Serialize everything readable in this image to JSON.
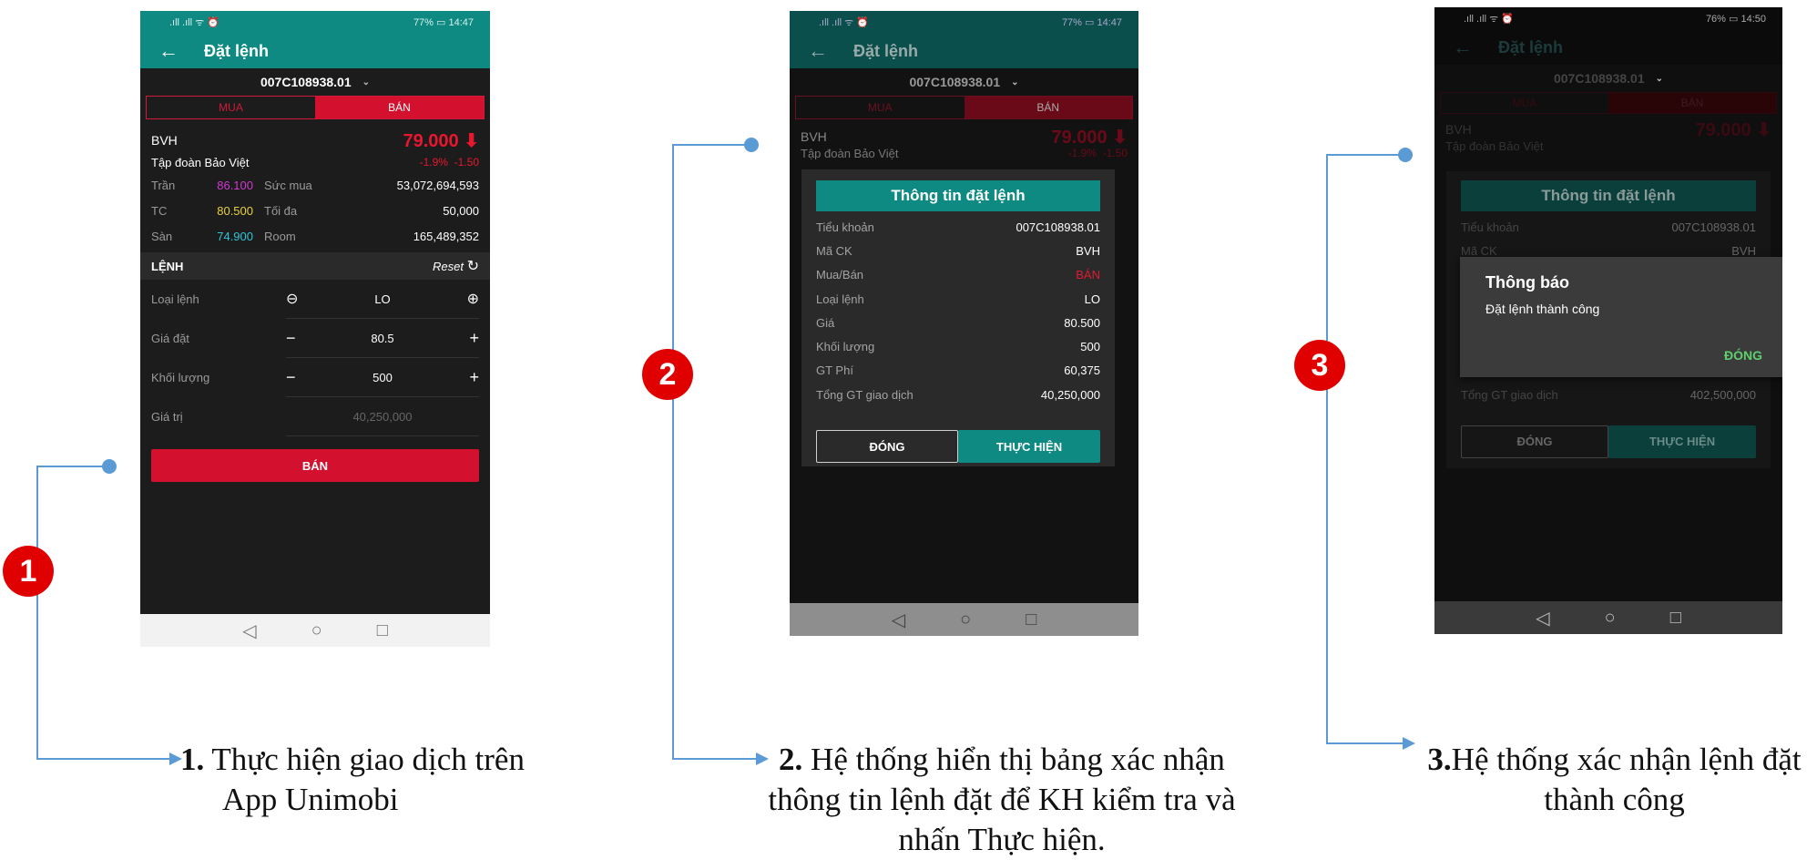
{
  "badges": [
    "1",
    "2",
    "3"
  ],
  "captions": {
    "c1_num": "1.",
    "c1_line1": " Thực hiện giao dịch trên",
    "c1_line2": "App Unimobi",
    "c2_num": "2.",
    "c2_line1": " Hệ thống hiển thị bảng xác nhận",
    "c2_line2": "thông tin lệnh đặt để KH kiểm tra và",
    "c2_line3": "nhấn Thực hiện.",
    "c3_num": "3.",
    "c3_line1": "Hệ thống xác nhận lệnh đặt",
    "c3_line2": "thành công"
  },
  "status": {
    "left": ".ıll .ıll ᯤ ⏰",
    "right_1": "77% ▭ 14:47",
    "right_3": "76% ▭ 14:50"
  },
  "app": {
    "title": "Đặt lệnh",
    "account": "007C108938.01",
    "tab_buy": "MUA",
    "tab_sell": "BÁN"
  },
  "stock": {
    "symbol": "BVH",
    "price": "79.000",
    "company": "Tập đoàn Bảo Việt",
    "change_pct": "-1.9%",
    "change": "-1.50",
    "ceiling_label": "Trần",
    "ceiling": "86.100",
    "ref_label": "TC",
    "ref": "80.500",
    "floor_label": "Sàn",
    "floor": "74.900",
    "buying_power_label": "Sức mua",
    "buying_power": "53,072,694,593",
    "max_label": "Tối đa",
    "max": "50,000",
    "room_label": "Room",
    "room": "165,489,352"
  },
  "order": {
    "section": "LỆNH",
    "reset": "Reset",
    "type_label": "Loại lệnh",
    "type": "LO",
    "price_label": "Giá đặt",
    "price": "80.5",
    "qty_label": "Khối lượng",
    "qty": "500",
    "value_label": "Giá trị",
    "value": "40,250,000",
    "submit": "BÁN"
  },
  "confirm": {
    "title": "Thông tin đặt lệnh",
    "rows": [
      {
        "label": "Tiểu khoản",
        "value": "007C108938.01"
      },
      {
        "label": "Mã CK",
        "value": "BVH"
      },
      {
        "label": "Mua/Bán",
        "value": "BÁN"
      },
      {
        "label": "Loại lệnh",
        "value": "LO"
      },
      {
        "label": "Giá",
        "value": "80.500"
      },
      {
        "label": "Khối lượng",
        "value": "500"
      },
      {
        "label": "GT Phí",
        "value": "60,375"
      },
      {
        "label": "Tổng GT giao dịch",
        "value": "40,250,000"
      }
    ],
    "close": "ĐÓNG",
    "execute": "THỰC HIỆN",
    "total_3": "402,500,000"
  },
  "notice": {
    "title": "Thông báo",
    "message": "Đặt lệnh thành công",
    "close": "ĐÓNG"
  },
  "nav": {
    "back": "◁",
    "home": "○",
    "recent": "□"
  },
  "colors": {
    "teal": "#0e8a83",
    "red": "#d4102f",
    "connector": "#5b9bd5"
  }
}
